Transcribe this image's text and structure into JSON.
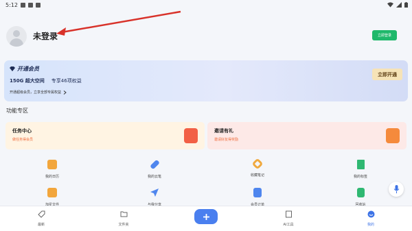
{
  "status_bar": {
    "time": "5:12"
  },
  "profile": {
    "title": "未登录",
    "login_button": "立即登录"
  },
  "vip_card": {
    "title": "开通会员",
    "storage": "150G 超大空间",
    "benefits": "专享46项权益",
    "subtitle": "开通超级会员，立享全部专属权益",
    "button": "立即开通"
  },
  "section": {
    "title": "功能专区"
  },
  "cards": {
    "task": {
      "title": "任务中心",
      "subtitle": "做任务得会员",
      "icon": "task-red-envelope-icon"
    },
    "invite": {
      "title": "邀请有礼",
      "subtitle": "邀请好友得奖励",
      "icon": "gift-icon"
    }
  },
  "features": [
    {
      "label": "我的日历",
      "icon": "calendar-icon",
      "color": "#f2a63c"
    },
    {
      "label": "我的云笔",
      "icon": "pen-icon",
      "color": "#4f86ee"
    },
    {
      "label": "收藏笔记",
      "icon": "link-icon",
      "color": "#f0a93e"
    },
    {
      "label": "我的标签",
      "icon": "bookmark-icon",
      "color": "#2fb872"
    },
    {
      "label": "加星文件",
      "icon": "star-folder-icon",
      "color": "#f2a63c"
    },
    {
      "label": "与我分享",
      "icon": "share-icon",
      "color": "#4f86ee"
    },
    {
      "label": "会员订单",
      "icon": "order-icon",
      "color": "#4f86ee"
    },
    {
      "label": "回收站",
      "icon": "trash-icon",
      "color": "#2fb872"
    }
  ],
  "nav": {
    "items": [
      {
        "label": "最新",
        "icon": "tag-icon"
      },
      {
        "label": "文件夹",
        "icon": "folder-icon"
      },
      {
        "label": "AI工具",
        "icon": "ai-tool-icon"
      },
      {
        "label": "我的",
        "icon": "profile-icon"
      }
    ],
    "active": "我的",
    "accent": "#3d73e6"
  }
}
